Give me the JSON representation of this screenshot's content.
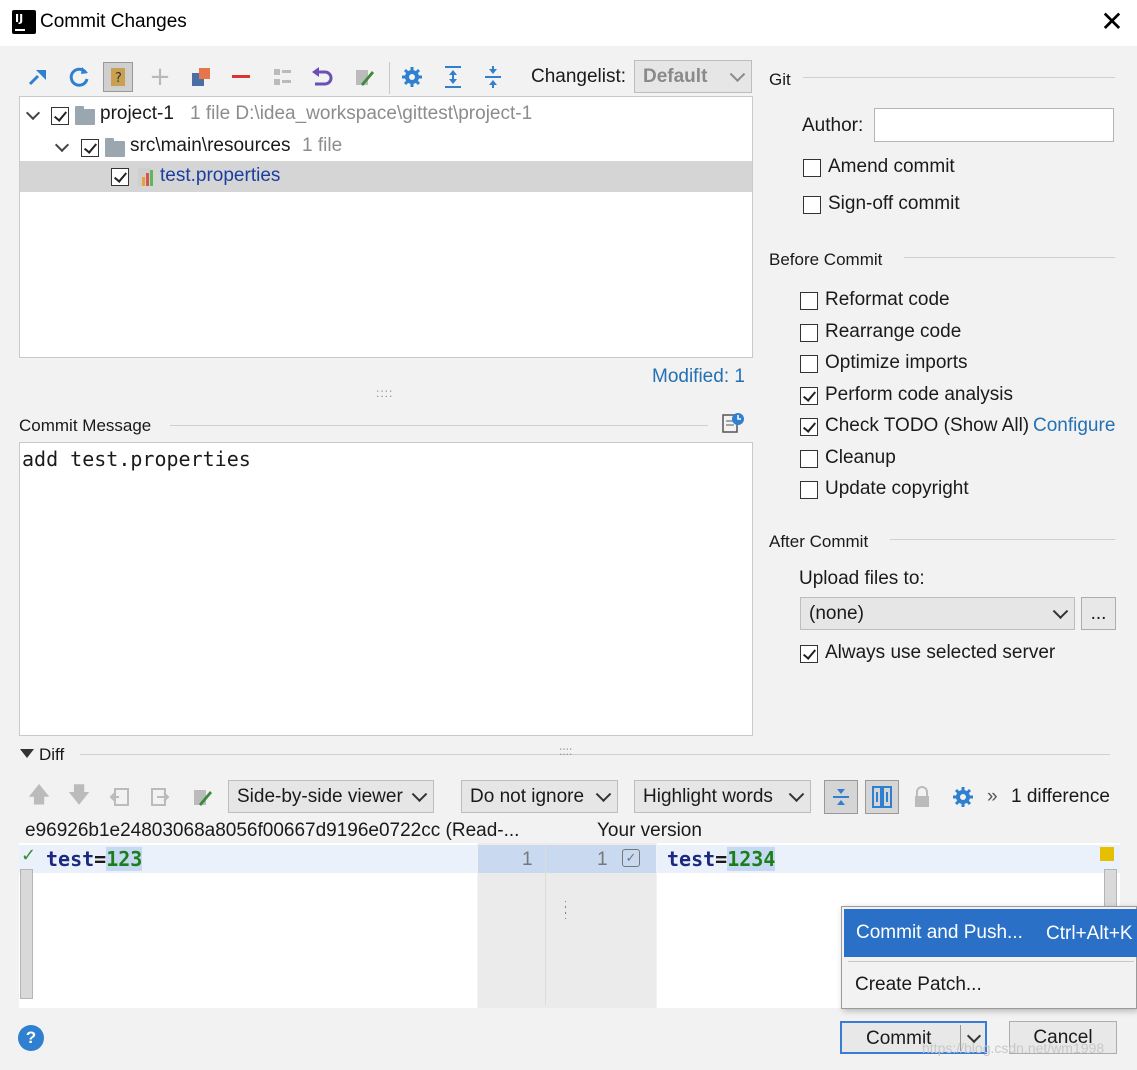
{
  "window": {
    "title": "Commit Changes"
  },
  "toolbar": {
    "changelist_label": "Changelist:",
    "changelist_value": "Default",
    "icons": [
      "move-to-changelist-icon",
      "refresh-icon",
      "show-unversioned-icon",
      "add-icon",
      "new-changelist-icon",
      "remove-icon",
      "group-by-icon",
      "rollback-icon",
      "edit-source-icon",
      "settings-icon",
      "expand-all-icon",
      "collapse-all-icon"
    ]
  },
  "tree": {
    "items": [
      {
        "name": "project-1",
        "meta": "1 file  D:\\idea_workspace\\gittest\\project-1",
        "checked": true
      },
      {
        "name": "src\\main\\resources",
        "meta": "1 file",
        "checked": true
      },
      {
        "name": "test.properties",
        "meta": "",
        "checked": true
      }
    ],
    "modified": "Modified: 1"
  },
  "commit_message": {
    "label": "Commit Message",
    "text": "add test.properties"
  },
  "git": {
    "section": "Git",
    "author_label": "Author:",
    "author_value": "",
    "amend": {
      "label": "Amend commit",
      "checked": false
    },
    "signoff": {
      "label": "Sign-off commit",
      "checked": false
    }
  },
  "before_commit": {
    "section": "Before Commit",
    "options": [
      {
        "label": "Reformat code",
        "checked": false
      },
      {
        "label": "Rearrange code",
        "checked": false
      },
      {
        "label": "Optimize imports",
        "checked": false
      },
      {
        "label": "Perform code analysis",
        "checked": true
      },
      {
        "label": "Check TODO (Show All)",
        "checked": true
      },
      {
        "label": "Cleanup",
        "checked": false
      },
      {
        "label": "Update copyright",
        "checked": false
      }
    ],
    "configure_link": "Configure"
  },
  "after_commit": {
    "section": "After Commit",
    "upload_label": "Upload files to:",
    "upload_value": "(none)",
    "browse_label": "...",
    "always_use": {
      "label": "Always use selected server",
      "checked": true
    }
  },
  "diff": {
    "label": "Diff",
    "viewer": "Side-by-side viewer",
    "ignore": "Do not ignore",
    "highlight": "Highlight words",
    "count": "1 difference",
    "more": "»",
    "left_title": "e96926b1e24803068a8056f00667d9196e0722cc (Read-...",
    "right_title": "Your version",
    "left_key": "test",
    "left_eq": "=",
    "left_val": "123",
    "right_key": "test",
    "right_eq": "=",
    "right_val": "1234",
    "left_line": "1",
    "right_line": "1"
  },
  "popup": {
    "commit_push": "Commit and Push...",
    "commit_push_shortcut": "Ctrl+Alt+K",
    "create_patch": "Create Patch..."
  },
  "buttons": {
    "commit": "Commit",
    "cancel": "Cancel",
    "help": "?"
  },
  "watermark": "https://blog.csdn.net/wm1998",
  "colors": {
    "accent": "#2a70c6",
    "link": "#2470b3",
    "added": "#1a7f1a"
  }
}
